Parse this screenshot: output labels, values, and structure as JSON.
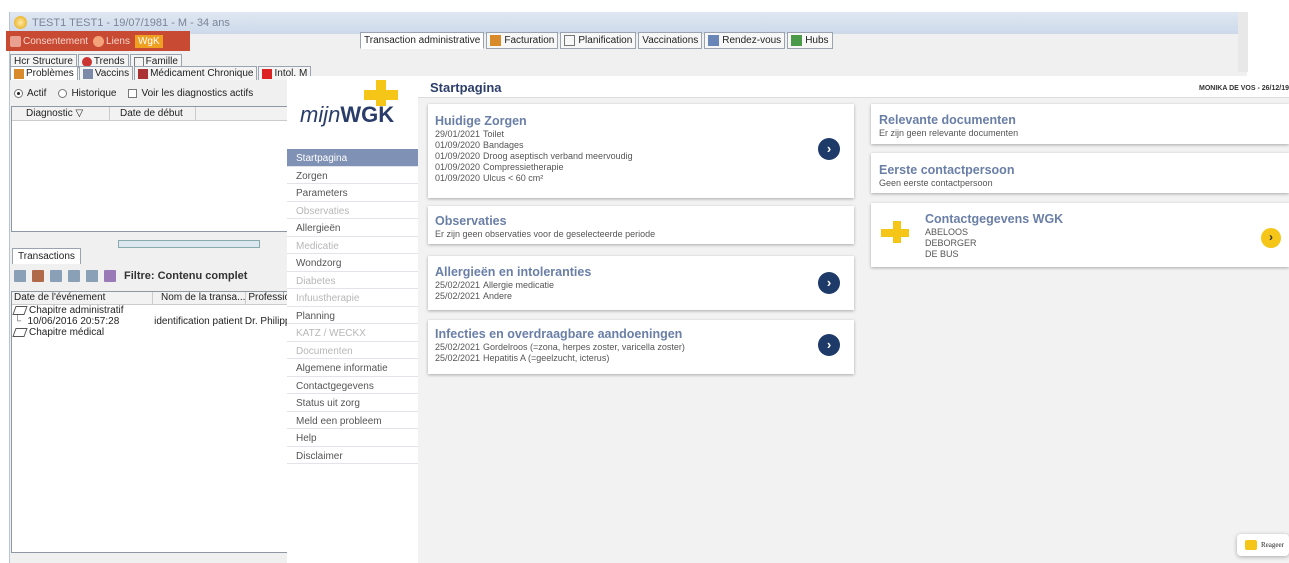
{
  "bg_window": {
    "title": "TEST1 TEST1 - 19/07/1981 - M - 34 ans",
    "toolbar": {
      "consent": "Consentement",
      "links": "Liens",
      "wgk": "WgK"
    },
    "tabs_row1": [
      "Hcr Structure",
      "Trends",
      "Famille"
    ],
    "tabs_row2": [
      "Problèmes",
      "Vaccins",
      "Médicament Chronique",
      "Intol. M"
    ],
    "radio_active": "Actif",
    "radio_history": "Historique",
    "check_all_diag": "Voir les diagnostics actifs",
    "diag_columns": [
      "Diagnostic",
      "Date de début"
    ],
    "transactions_tab": "Transactions",
    "filter_label": "Filtre: Contenu complet",
    "tr_columns": [
      "Date de l'événement",
      "Nom de la transa...",
      "Professior"
    ],
    "tr_rows": [
      {
        "text": "Chapitre administratif"
      },
      {
        "date": "10/06/2016 20:57:28",
        "name": "identification patient",
        "prof": "Dr. Philippe"
      },
      {
        "text": "Chapitre médical"
      }
    ],
    "right_tabs": [
      "Transaction administrative",
      "Facturation",
      "Planification",
      "Vaccinations",
      "Rendez-vous",
      "Hubs"
    ]
  },
  "mijnwgk": {
    "logo_main": "mijn",
    "logo_brand": "WGK",
    "page_title": "Startpagina",
    "user": "MONIKA DE VOS - 26/12/19",
    "nav": [
      {
        "label": "Startpagina",
        "state": "active"
      },
      {
        "label": "Zorgen",
        "state": "normal"
      },
      {
        "label": "Parameters",
        "state": "normal"
      },
      {
        "label": "Observaties",
        "state": "disabled"
      },
      {
        "label": "Allergieën",
        "state": "normal"
      },
      {
        "label": "Medicatie",
        "state": "disabled"
      },
      {
        "label": "Wondzorg",
        "state": "normal"
      },
      {
        "label": "Diabetes",
        "state": "disabled"
      },
      {
        "label": "Infuustherapie",
        "state": "disabled"
      },
      {
        "label": "Planning",
        "state": "normal"
      },
      {
        "label": "KATZ / WECKX",
        "state": "disabled"
      },
      {
        "label": "Documenten",
        "state": "disabled"
      },
      {
        "label": "Algemene informatie",
        "state": "normal"
      },
      {
        "label": "Contactgegevens",
        "state": "normal"
      },
      {
        "label": "Status uit zorg",
        "state": "normal"
      },
      {
        "label": "Meld een probleem",
        "state": "normal"
      },
      {
        "label": "Help",
        "state": "normal"
      },
      {
        "label": "Disclaimer",
        "state": "normal"
      }
    ],
    "cards": {
      "zorgen": {
        "title": "Huidige Zorgen",
        "rows": [
          {
            "date": "29/01/2021",
            "text": "Toilet"
          },
          {
            "date": "01/09/2020",
            "text": "Bandages"
          },
          {
            "date": "01/09/2020",
            "text": "Droog aseptisch verband meervoudig"
          },
          {
            "date": "01/09/2020",
            "text": "Compressietherapie"
          },
          {
            "date": "01/09/2020",
            "text": "Ulcus < 60 cm²"
          }
        ]
      },
      "observaties": {
        "title": "Observaties",
        "text": "Er zijn geen observaties voor de geselecteerde periode"
      },
      "allergie": {
        "title": "Allergieën en intoleranties",
        "rows": [
          {
            "date": "25/02/2021",
            "text": "Allergie medicatie"
          },
          {
            "date": "25/02/2021",
            "text": "Andere"
          }
        ]
      },
      "infecties": {
        "title": "Infecties en overdraagbare aandoeningen",
        "rows": [
          {
            "date": "25/02/2021",
            "text": "Gordelroos (=zona, herpes zoster, varicella zoster)"
          },
          {
            "date": "25/02/2021",
            "text": "Hepatitis A (=geelzucht, icterus)"
          }
        ]
      },
      "documenten": {
        "title": "Relevante documenten",
        "text": "Er zijn geen relevante documenten"
      },
      "contact": {
        "title": "Eerste contactpersoon",
        "text": "Geen eerste contactpersoon"
      },
      "wgk_contact": {
        "title": "Contactgegevens WGK",
        "lines": [
          "ABELOOS",
          "DEBORGER",
          "DE BUS"
        ]
      }
    },
    "chat_label": "Reageer"
  },
  "colors": {
    "navy": "#1d3a68",
    "accent_yellow": "#f5c518",
    "nav_active": "#7f91b4",
    "card_title": "#6a7fa7"
  }
}
